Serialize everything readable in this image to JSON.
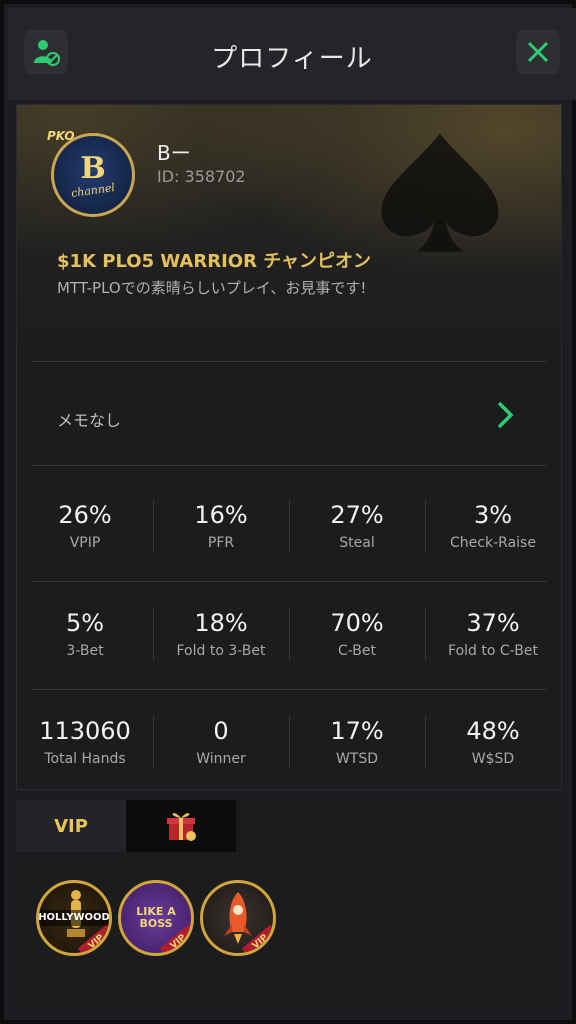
{
  "header": {
    "title": "プロフィール"
  },
  "profile": {
    "avatar_big": "B",
    "avatar_small": "channel",
    "avatar_tag": "PKO",
    "name": "Bー",
    "id": "ID: 358702",
    "achievement_title": "$1K PLO5 WARRIOR チャンピオン",
    "achievement_subtitle": "MTT-PLOでの素晴らしいプレイ、お見事です!"
  },
  "memo": {
    "label": "メモなし"
  },
  "stats": [
    [
      {
        "value": "26%",
        "label": "VPIP"
      },
      {
        "value": "16%",
        "label": "PFR"
      },
      {
        "value": "27%",
        "label": "Steal"
      },
      {
        "value": "3%",
        "label": "Check-Raise"
      }
    ],
    [
      {
        "value": "5%",
        "label": "3-Bet"
      },
      {
        "value": "18%",
        "label": "Fold to 3-Bet"
      },
      {
        "value": "70%",
        "label": "C-Bet"
      },
      {
        "value": "37%",
        "label": "Fold to C-Bet"
      }
    ],
    [
      {
        "value": "113060",
        "label": "Total Hands"
      },
      {
        "value": "0",
        "label": "Winner"
      },
      {
        "value": "17%",
        "label": "WTSD"
      },
      {
        "value": "48%",
        "label": "W$SD"
      }
    ]
  ],
  "tabs": {
    "vip": "VIP"
  },
  "badges": [
    {
      "text": "HOLLYWOOD",
      "ribbon": "VIP"
    },
    {
      "text": "LIKE A BOSS",
      "ribbon": "VIP"
    },
    {
      "text": "",
      "ribbon": "VIP"
    }
  ],
  "colors": {
    "accent_green": "#2ecc71",
    "gold": "#e4c15f"
  },
  "icons": {
    "left_button": "user-block-icon",
    "right_button": "close-icon",
    "memo_arrow": "chevron-right-icon"
  }
}
